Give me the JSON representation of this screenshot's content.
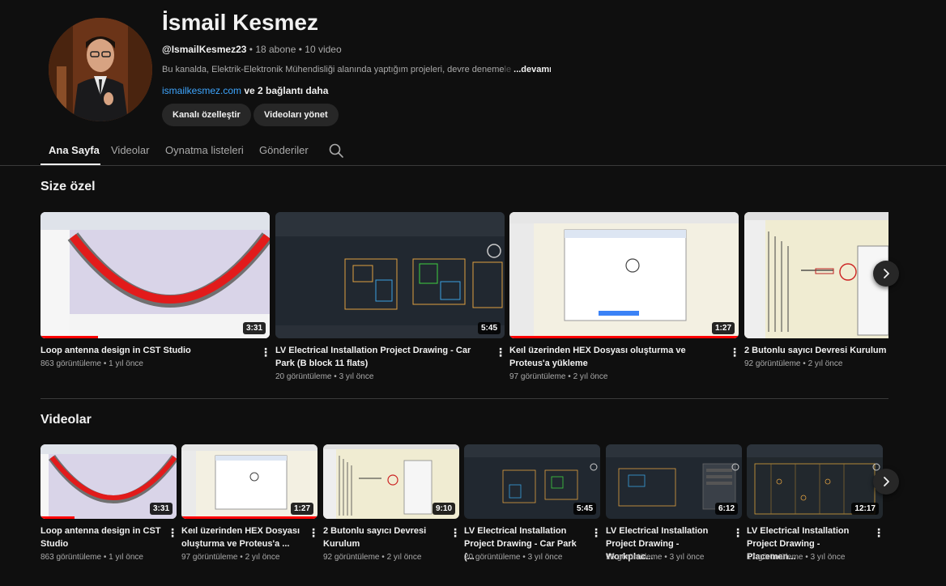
{
  "channel": {
    "name": "İsmail Kesmez",
    "handle": "@IsmailKesmez23",
    "subscribers": "18 abone",
    "video_count": "10 video",
    "separator": "•",
    "description": "Bu kanalda, Elektrik-Elektronik Mühendisliği alanında yaptığım projeleri, devre deneme",
    "description_fade": "le",
    "more_label": "...devamı",
    "link": "ismailkesmez.com",
    "links_more": " ve 2 bağlantı daha",
    "customize_button": "Kanalı özelleştir",
    "manage_button": "Videoları yönet"
  },
  "tabs": [
    "Ana Sayfa",
    "Videolar",
    "Oynatma listeleri",
    "Gönderiler"
  ],
  "sections": {
    "for_you": {
      "title": "Size özel",
      "videos": [
        {
          "title": "Loop antenna design in CST Studio",
          "views": "863 görüntüleme",
          "age": "1 yıl önce",
          "duration": "3:31",
          "progress": 0.25
        },
        {
          "title": "LV Electrical Installation Project Drawing - Car Park (B block 11 flats)",
          "views": "20 görüntüleme",
          "age": "3 yıl önce",
          "duration": "5:45",
          "progress": 0
        },
        {
          "title": "Keıl üzerinden HEX Dosyası oluşturma ve  Proteus'a yükleme",
          "views": "97 görüntüleme",
          "age": "2 yıl önce",
          "duration": "1:27",
          "progress": 1.0
        },
        {
          "title": "2 Butonlu sayıcı Devresi Kurulum",
          "views": "92 görüntüleme",
          "age": "2 yıl önce",
          "duration": "",
          "progress": 0
        }
      ]
    },
    "videos": {
      "title": "Videolar",
      "videos": [
        {
          "title": "Loop antenna design in CST Studio",
          "views": "863 görüntüleme",
          "age": "1 yıl önce",
          "duration": "3:31",
          "progress": 0.25
        },
        {
          "title": "Keıl üzerinden HEX Dosyası oluşturma ve  Proteus'a ...",
          "views": "97 görüntüleme",
          "age": "2 yıl önce",
          "duration": "1:27",
          "progress": 1.0
        },
        {
          "title": "2 Butonlu sayıcı Devresi Kurulum",
          "views": "92 görüntüleme",
          "age": "2 yıl önce",
          "duration": "9:10",
          "progress": 0
        },
        {
          "title": "LV Electrical Installation Project Drawing - Car Park (...",
          "views": "20 görüntüleme",
          "age": "3 yıl önce",
          "duration": "5:45",
          "progress": 0
        },
        {
          "title": "LV Electrical Installation Project Drawing -  Workplac...",
          "views": "16 görüntüleme",
          "age": "3 yıl önce",
          "duration": "6:12",
          "progress": 0
        },
        {
          "title": "LV Electrical Installation Project Drawing - Placemen...",
          "views": "17 görüntüleme",
          "age": "3 yıl önce",
          "duration": "12:17",
          "progress": 0
        }
      ]
    }
  },
  "icons": {
    "search": "search-icon",
    "next": "chevron-right-icon",
    "more": "kebab-menu-icon"
  },
  "colors": {
    "background": "#0f0f0f",
    "link": "#3ea6ff",
    "progress": "#ff0000"
  }
}
